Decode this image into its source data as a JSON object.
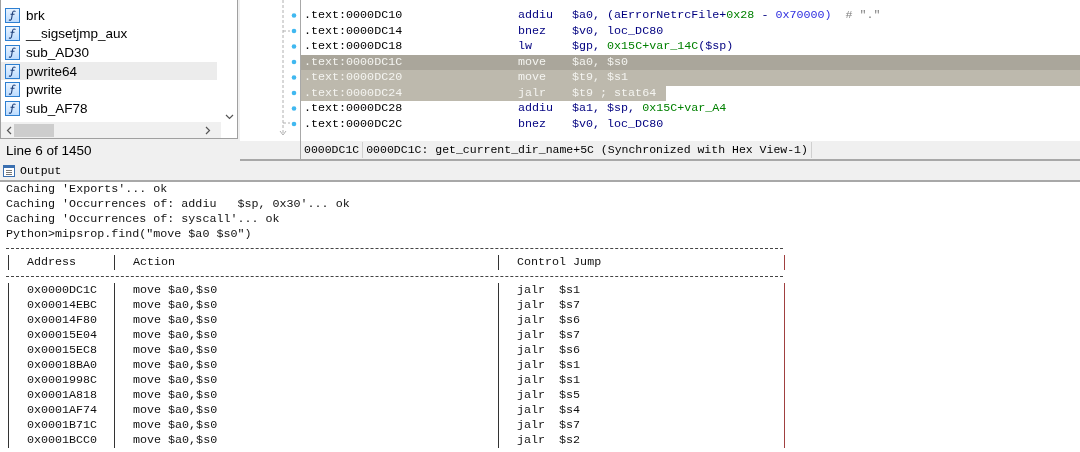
{
  "functions": {
    "items": [
      {
        "name": "brk",
        "selected": false
      },
      {
        "name": "__sigsetjmp_aux",
        "selected": false
      },
      {
        "name": "sub_AD30",
        "selected": false
      },
      {
        "name": "pwrite64",
        "selected": true
      },
      {
        "name": "pwrite",
        "selected": false
      },
      {
        "name": "sub_AF78",
        "selected": false
      }
    ],
    "status": "Line 6 of 1450"
  },
  "disassembly": {
    "lines": [
      {
        "address": ".text:0000DC10",
        "mnemonic": "addiu",
        "operands": [
          {
            "kind": "reg",
            "text": "$a0, (aErrorNetrcFile+"
          },
          {
            "kind": "num",
            "text": "0x28"
          },
          {
            "kind": "reg",
            "text": " - "
          },
          {
            "kind": "imm",
            "text": "0x70000)"
          },
          {
            "kind": "comment",
            "text": "  # \".\""
          }
        ],
        "current": false,
        "selected": false
      },
      {
        "address": ".text:0000DC14",
        "mnemonic": "bnez",
        "operands": [
          {
            "kind": "reg",
            "text": "$v0, loc_DC80"
          }
        ],
        "current": false,
        "selected": false
      },
      {
        "address": ".text:0000DC18",
        "mnemonic": "lw",
        "operands": [
          {
            "kind": "reg",
            "text": "$gp, "
          },
          {
            "kind": "num",
            "text": "0x15C+var_14C"
          },
          {
            "kind": "reg",
            "text": "($sp)"
          }
        ],
        "current": false,
        "selected": false
      },
      {
        "address": ".text:0000DC1C",
        "mnemonic": "move",
        "operands": [
          {
            "kind": "reg",
            "text": "$a0, $s0"
          }
        ],
        "current": true,
        "selected": true
      },
      {
        "address": ".text:0000DC20",
        "mnemonic": "move",
        "operands": [
          {
            "kind": "reg",
            "text": "$t9, $s1"
          }
        ],
        "current": false,
        "selected": true
      },
      {
        "address": ".text:0000DC24",
        "mnemonic": "jalr",
        "operands": [
          {
            "kind": "reg",
            "text": "$t9 ; stat64"
          }
        ],
        "current": false,
        "selected": true
      },
      {
        "address": ".text:0000DC28",
        "mnemonic": "addiu",
        "operands": [
          {
            "kind": "reg",
            "text": "$a1, $sp, "
          },
          {
            "kind": "num",
            "text": "0x15C+var_A4"
          }
        ],
        "current": false,
        "selected": false
      },
      {
        "address": ".text:0000DC2C",
        "mnemonic": "bnez",
        "operands": [
          {
            "kind": "reg",
            "text": "$v0, loc_DC80"
          }
        ],
        "current": false,
        "selected": false
      }
    ],
    "status": {
      "address": "0000DC1C",
      "location": "0000DC1C: get_current_dir_name+5C (Synchronized with Hex View-1)"
    }
  },
  "output": {
    "title": "Output",
    "lines": [
      "Caching 'Exports'... ok",
      "Caching 'Occurrences of: addiu   $sp, 0x30'... ok",
      "Caching 'Occurrences of: syscall'... ok",
      "Python>mipsrop.find(\"move $a0 $s0\")"
    ],
    "table": {
      "columns": [
        "Address",
        "Action",
        "Control Jump"
      ],
      "rows": [
        [
          "0x0000DC1C",
          "move $a0,$s0",
          "jalr  $s1"
        ],
        [
          "0x00014EBC",
          "move $a0,$s0",
          "jalr  $s7"
        ],
        [
          "0x00014F80",
          "move $a0,$s0",
          "jalr  $s6"
        ],
        [
          "0x00015E04",
          "move $a0,$s0",
          "jalr  $s7"
        ],
        [
          "0x00015EC8",
          "move $a0,$s0",
          "jalr  $s6"
        ],
        [
          "0x00018BA0",
          "move $a0,$s0",
          "jalr  $s1"
        ],
        [
          "0x0001998C",
          "move $a0,$s0",
          "jalr  $s1"
        ],
        [
          "0x0001A818",
          "move $a0,$s0",
          "jalr  $s5"
        ],
        [
          "0x0001AF74",
          "move $a0,$s0",
          "jalr  $s4"
        ],
        [
          "0x0001B71C",
          "move $a0,$s0",
          "jalr  $s7"
        ],
        [
          "0x0001BCC0",
          "move $a0,$s0",
          "jalr  $s2"
        ]
      ]
    }
  }
}
